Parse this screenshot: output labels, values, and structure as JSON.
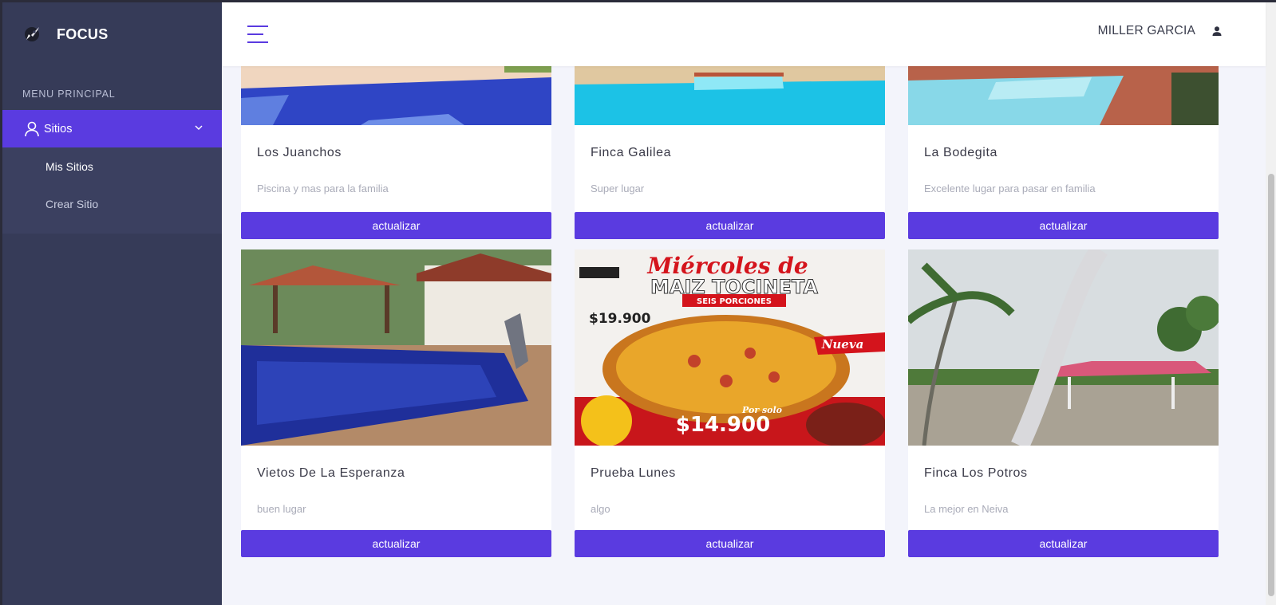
{
  "app": {
    "brand": "FOCUS"
  },
  "header": {
    "user_name": "MILLER GARCIA"
  },
  "sidebar": {
    "menu_title": "MENU PRINCIPAL",
    "active_group": "Sitios",
    "items": [
      {
        "label": "Mis Sitios",
        "active": true
      },
      {
        "label": "Crear Sitio",
        "active": false
      }
    ]
  },
  "cards": [
    {
      "name": "Los Juanchos",
      "description": "Piscina y mas para la familia",
      "button": "actualizar"
    },
    {
      "name": "Finca Galilea",
      "description": "Super lugar",
      "button": "actualizar"
    },
    {
      "name": "La Bodegita",
      "description": "Excelente lugar para pasar en familia",
      "button": "actualizar"
    },
    {
      "name": "Vietos De La Esperanza",
      "description": "buen lugar",
      "button": "actualizar"
    },
    {
      "name": "Prueba Lunes",
      "description": "algo",
      "button": "actualizar"
    },
    {
      "name": "Finca Los Potros",
      "description": "La mejor en Neiva",
      "button": "actualizar"
    }
  ],
  "promo": {
    "line1": "Miércoles de",
    "line2": "MAIZ TOCINETA",
    "line3": "SEIS PORCIONES",
    "old_price": "$19.900",
    "badge": "Nueva",
    "por_solo": "Por solo",
    "price": "$14.900"
  },
  "colors": {
    "accent": "#5a3be0",
    "sidebar": "#363b58",
    "background": "#f3f4fb"
  }
}
